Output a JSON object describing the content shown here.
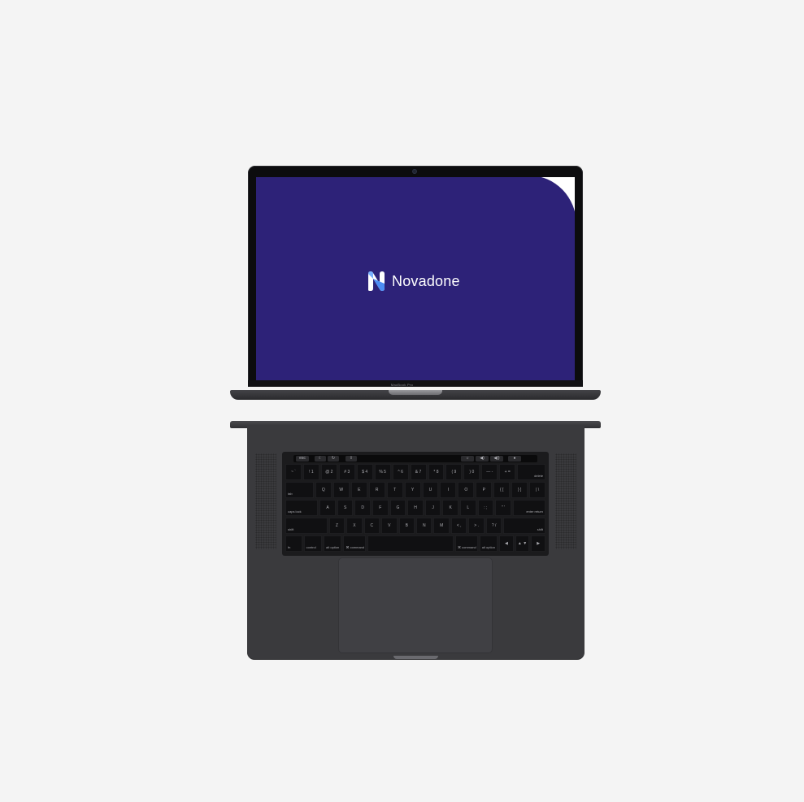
{
  "screen": {
    "brand_name": "Novadone",
    "colors": {
      "background": "#2d2278",
      "corner": "#ffffff",
      "text": "#ffffff",
      "logo_light": "#ffffff",
      "logo_accent": "#4d8df3"
    }
  },
  "device": {
    "model_label": "MacBook Pro",
    "touchbar": {
      "left": [
        "esc",
        "☾",
        "↻",
        "⇪"
      ],
      "right": [
        "☼",
        "◀)",
        "◀))",
        "●"
      ]
    },
    "keyboard": {
      "rows": [
        [
          "~ `",
          "! 1",
          "@ 2",
          "# 3",
          "$ 4",
          "% 5",
          "^ 6",
          "& 7",
          "* 8",
          "( 9",
          ") 0",
          "— -",
          "+ =",
          "delete"
        ],
        [
          "tab",
          "Q",
          "W",
          "E",
          "R",
          "T",
          "Y",
          "U",
          "I",
          "O",
          "P",
          "{ [",
          "} ]",
          "| \\"
        ],
        [
          "caps lock",
          "A",
          "S",
          "D",
          "F",
          "G",
          "H",
          "J",
          "K",
          "L",
          ": ;",
          "\" '",
          "enter return"
        ],
        [
          "shift",
          "Z",
          "X",
          "C",
          "V",
          "B",
          "N",
          "M",
          "< ,",
          "> .",
          "? /",
          "shift"
        ],
        [
          "fn",
          "control",
          "alt option",
          "⌘ command",
          "",
          "⌘ command",
          "alt option",
          "◀",
          "▲ ▼",
          "▶"
        ]
      ]
    }
  }
}
